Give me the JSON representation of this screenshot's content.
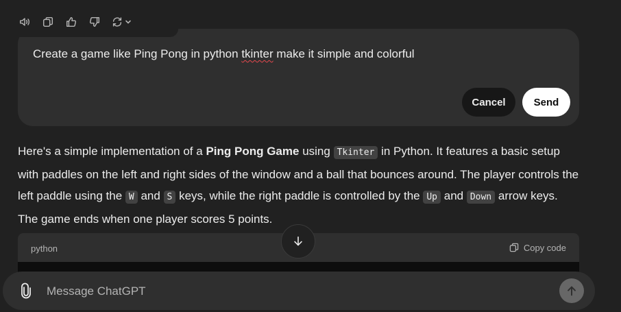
{
  "toolbar": {
    "icons": [
      "speaker-icon",
      "copy-icon",
      "thumbs-up-icon",
      "thumbs-down-icon",
      "regenerate-icon",
      "chevron-down-icon"
    ]
  },
  "edit": {
    "text_before": "Create a game like Ping Pong in python ",
    "text_misspelled": "tkinter",
    "text_after": " make it simple and colorful",
    "cancel_label": "Cancel",
    "send_label": "Send"
  },
  "answer": {
    "p1": "Here's a simple implementation of a ",
    "b1": "Ping Pong Game",
    "p2": " using ",
    "c1": "Tkinter",
    "p3": " in Python. It features a basic setup with paddles on the left and right sides of the window and a ball that bounces around. The player controls the left paddle using the ",
    "c2": "W",
    "p4": " and ",
    "c3": "S",
    "p5": " keys, while the right paddle is controlled by the ",
    "c4": "Up",
    "p6": " and ",
    "c5": "Down",
    "p7": " arrow keys. The game ends when one player scores 5 points."
  },
  "codeblock": {
    "language": "python",
    "copy_label": "Copy code"
  },
  "composer": {
    "placeholder": "Message ChatGPT",
    "value": ""
  },
  "colors": {
    "background": "#212121",
    "surface": "#2f2f2f",
    "text": "#ececec",
    "muted": "#b4b4b4"
  }
}
